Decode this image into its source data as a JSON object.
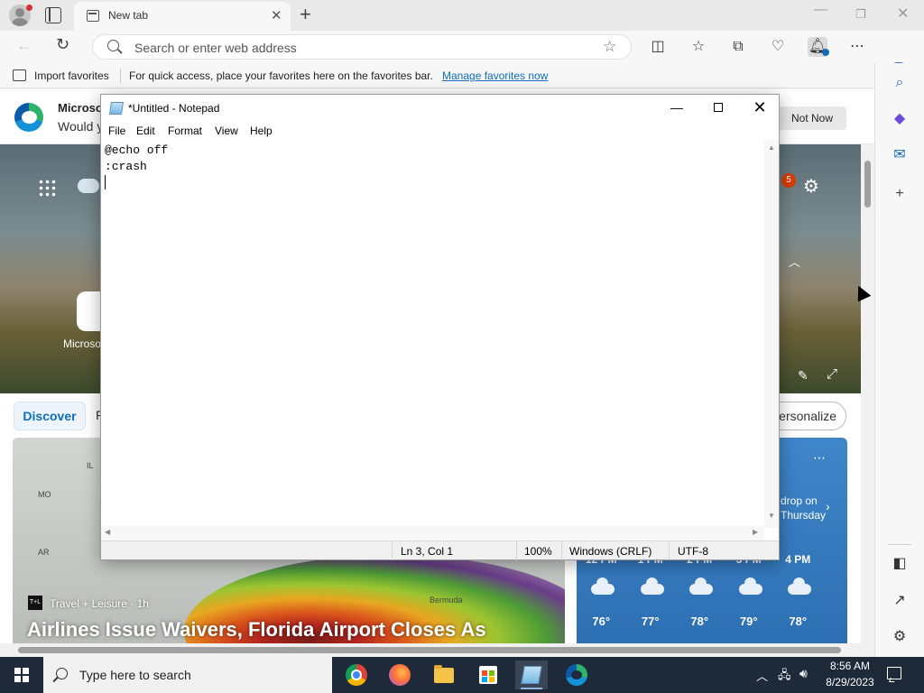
{
  "browser": {
    "tab": {
      "title": "New tab"
    },
    "omnibox": {
      "placeholder": "Search or enter web address"
    },
    "favorites_bar": {
      "import_label": "Import favorites",
      "hint": "For quick access, place your favorites here on the favorites bar.",
      "manage_link": "Manage favorites now"
    },
    "notification_badge_color": "#0f6cbd"
  },
  "page": {
    "banner": {
      "title": "Microsof",
      "subtitle": "Would y",
      "not_now_label": "Not Now"
    },
    "hero": {
      "badge_count": "5",
      "tile_label": "Microso"
    },
    "feed": {
      "discover_label": "Discover",
      "next_tab_fragment": "F",
      "personalize_label": "Personalize"
    },
    "news": {
      "source": "Travel + Leisure · 1h",
      "source_logo": "T+L",
      "headline": "Airlines Issue Waivers, Florida Airport Closes As",
      "map_labels": [
        "MO",
        "AR",
        "IL",
        "Bermuda"
      ]
    },
    "weather": {
      "alert_text": "drop on Thursday",
      "hours": [
        {
          "time": "12 PM",
          "temp": "76°"
        },
        {
          "time": "1 PM",
          "temp": "77°"
        },
        {
          "time": "2 PM",
          "temp": "78°"
        },
        {
          "time": "3 PM",
          "temp": "79°"
        },
        {
          "time": "4 PM",
          "temp": "78°"
        }
      ]
    }
  },
  "notepad": {
    "title": "*Untitled - Notepad",
    "menu": [
      "File",
      "Edit",
      "Format",
      "View",
      "Help"
    ],
    "content_lines": [
      "@echo off",
      ":crash",
      ""
    ],
    "status": {
      "position": "Ln 3, Col 1",
      "zoom": "100%",
      "line_endings": "Windows (CRLF)",
      "encoding": "UTF-8"
    }
  },
  "taskbar": {
    "search_placeholder": "Type here to search",
    "pinned_apps": [
      "chrome-icon",
      "firefox-icon",
      "file-explorer-icon",
      "store-icon",
      "notepad-icon",
      "edge-icon"
    ],
    "active_app": "notepad-icon",
    "time": "8:56 AM",
    "date": "8/29/2023"
  }
}
